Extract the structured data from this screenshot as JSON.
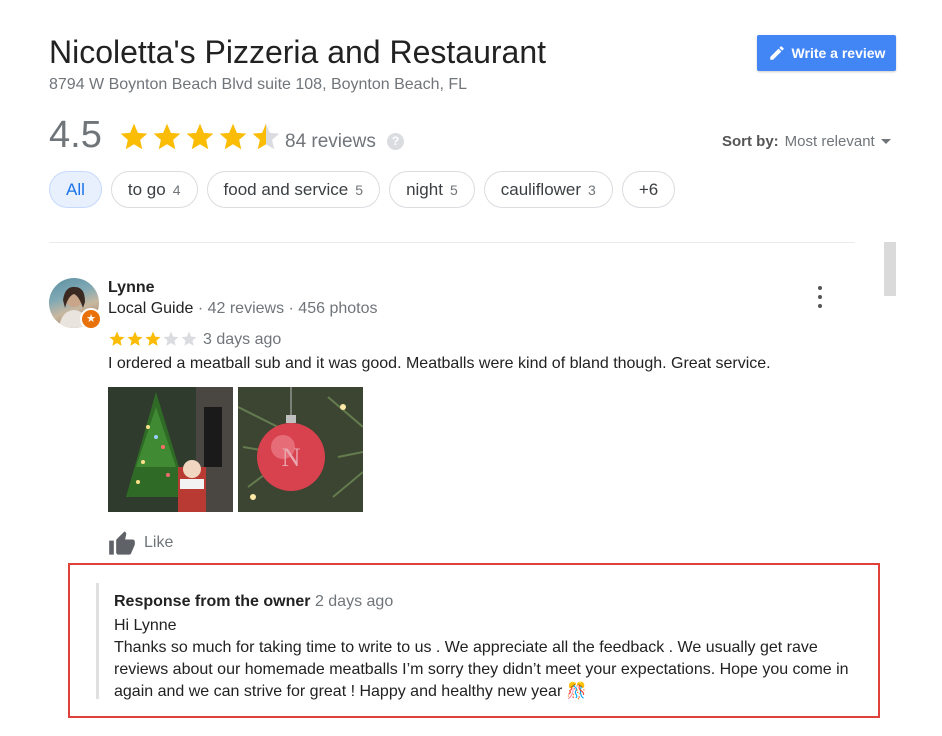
{
  "business": {
    "name": "Nicoletta's Pizzeria and Restaurant",
    "address": "8794 W Boynton Beach Blvd suite 108, Boynton Beach, FL",
    "rating": "4.5",
    "rating_value": 4.5,
    "reviews_count": "84 reviews"
  },
  "actions": {
    "write_review": "Write a review"
  },
  "sort": {
    "label": "Sort by:",
    "value": "Most relevant"
  },
  "filters": [
    {
      "label": "All",
      "count": "",
      "active": true
    },
    {
      "label": "to go",
      "count": "4"
    },
    {
      "label": "food and service",
      "count": "5"
    },
    {
      "label": "night",
      "count": "5"
    },
    {
      "label": "cauliflower",
      "count": "3"
    },
    {
      "label": "+6",
      "count": ""
    }
  ],
  "review": {
    "author": "Lynne",
    "guide": "Local Guide",
    "meta": " · 42 reviews · 456 photos",
    "rating_value": 3,
    "date": "3 days ago",
    "text": "I ordered a meatball sub and it was good. Meatballs were kind of bland though. Great service.",
    "like_label": "Like"
  },
  "owner_response": {
    "heading": "Response from the owner",
    "date": "2 days ago",
    "greeting": "Hi Lynne",
    "body": "Thanks so much for taking time to write to us . We appreciate all the feedback . We usually get rave reviews about our homemade meatballs I’m sorry they didn’t meet your expectations. Hope you come in again and we can strive for great ! Happy and healthy new year 🎊"
  },
  "colors": {
    "star": "#fbbc04",
    "star_empty": "#dadce0",
    "primary": "#4285f4",
    "highlight_border": "#e0403a"
  }
}
